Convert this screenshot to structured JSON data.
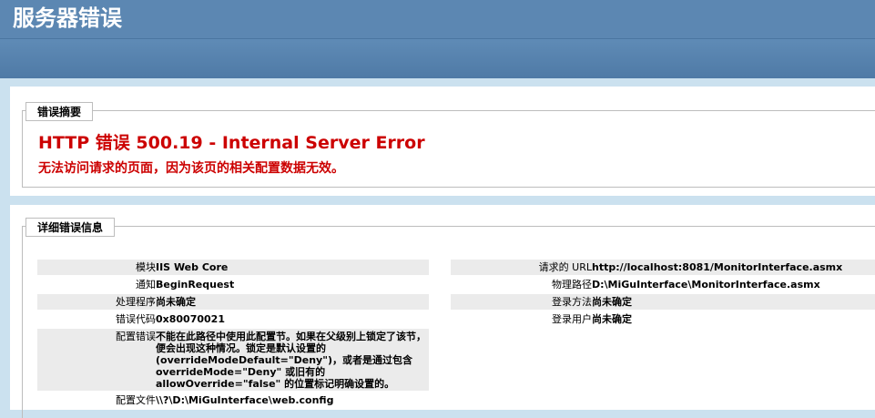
{
  "header": {
    "title": "服务器错误"
  },
  "summary": {
    "legend": "错误摘要",
    "error_title": "HTTP 错误 500.19 - Internal Server Error",
    "error_description": "无法访问请求的页面，因为该页的相关配置数据无效。"
  },
  "details": {
    "legend": "详细错误信息",
    "left": [
      {
        "label": "模块",
        "value": "IIS Web Core"
      },
      {
        "label": "通知",
        "value": "BeginRequest"
      },
      {
        "label": "处理程序",
        "value": "尚未确定"
      },
      {
        "label": "错误代码",
        "value": "0x80070021"
      },
      {
        "label": "配置错误",
        "value": "不能在此路径中使用此配置节。如果在父级别上锁定了该节，便会出现这种情况。锁定是默认设置的(overrideModeDefault=\"Deny\")，或者是通过包含 overrideMode=\"Deny\" 或旧有的 allowOverride=\"false\" 的位置标记明确设置的。"
      },
      {
        "label": "配置文件",
        "value": "\\\\?\\D:\\MiGuInterface\\web.config"
      }
    ],
    "right": [
      {
        "label": "请求的 URL",
        "value": "http://localhost:8081/MonitorInterface.asmx"
      },
      {
        "label": "物理路径",
        "value": "D:\\MiGuInterface\\MonitorInterface.asmx"
      },
      {
        "label": "登录方法",
        "value": "尚未确定"
      },
      {
        "label": "登录用户",
        "value": "尚未确定"
      }
    ]
  }
}
